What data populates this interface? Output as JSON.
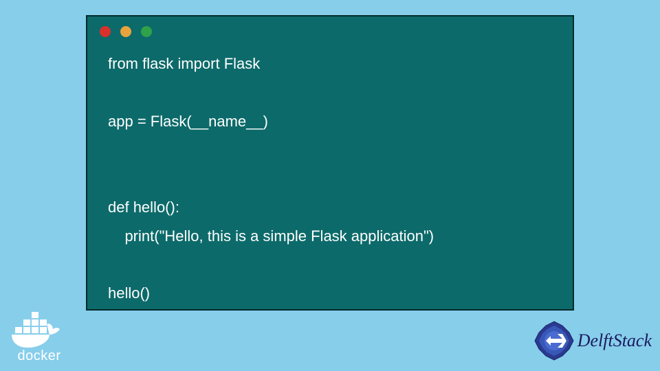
{
  "code": {
    "lines": [
      "from flask import Flask",
      "",
      "app = Flask(__name__)",
      "",
      "",
      "def hello():",
      "    print(\"Hello, this is a simple Flask application\")",
      "",
      "hello()"
    ]
  },
  "logos": {
    "docker_label": "docker",
    "delft_label": "DelftStack"
  },
  "colors": {
    "page_bg": "#87ceeb",
    "window_bg": "#0d6a6a",
    "code_text": "#ffffff",
    "traffic_red": "#d9302c",
    "traffic_yellow": "#e8a33d",
    "traffic_green": "#2fa24a",
    "delft_text": "#1a1a5c"
  }
}
